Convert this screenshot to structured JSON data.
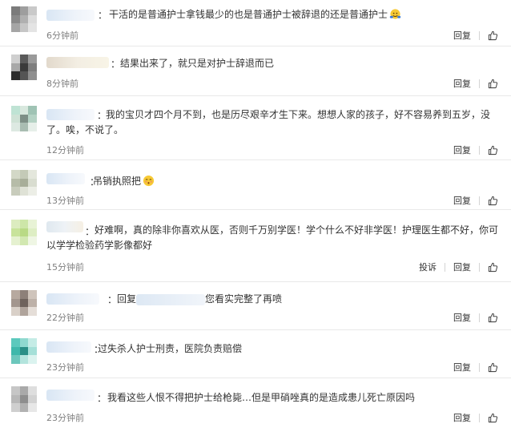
{
  "colors": {
    "text": "#333333",
    "meta": "#808080",
    "divider": "#e9e9e9"
  },
  "icons": {
    "like": "thumbs-up-icon",
    "emoji_hug": "hug-emoji-icon",
    "emoji_blush": "blush-emoji-icon"
  },
  "comments": [
    {
      "colon": "：",
      "text": "干活的是普通护士拿钱最少的也是普通护士被辞退的还是普通护士",
      "time": "6分钟前",
      "reply": "回复"
    },
    {
      "colon": "：",
      "text": "结果出来了，就只是对护士辞退而已",
      "time": "8分钟前",
      "reply": "回复"
    },
    {
      "colon": "：",
      "text": "我的宝贝才四个月不到，也是历尽艰辛才生下来。想想人家的孩子，好不容易养到五岁，没了。唉，不说了。",
      "time": "12分钟前",
      "reply": "回复"
    },
    {
      "colon": "：",
      "text": "吊销执照把",
      "time": "13分钟前",
      "reply": "回复"
    },
    {
      "colon": "：",
      "text": "好难啊，真的除非你喜欢从医，否则千万别学医！学个什么不好非学医！护理医生都不好，你可以学学检验药学影像都好",
      "time": "15分钟前",
      "report": "投诉",
      "reply": "回复"
    },
    {
      "colon": "：",
      "reply_prefix": "回复",
      "text": "您看实完整了再喷",
      "time": "22分钟前",
      "reply": "回复"
    },
    {
      "colon": "：",
      "text": "过失杀人护士刑责，医院负责赔偿",
      "time": "23分钟前",
      "reply": "回复"
    },
    {
      "colon": "：",
      "text": "我看这些人恨不得把护士给枪毙…但是甲硝唑真的是造成患儿死亡原因吗",
      "time": "23分钟前",
      "reply": "回复"
    }
  ]
}
